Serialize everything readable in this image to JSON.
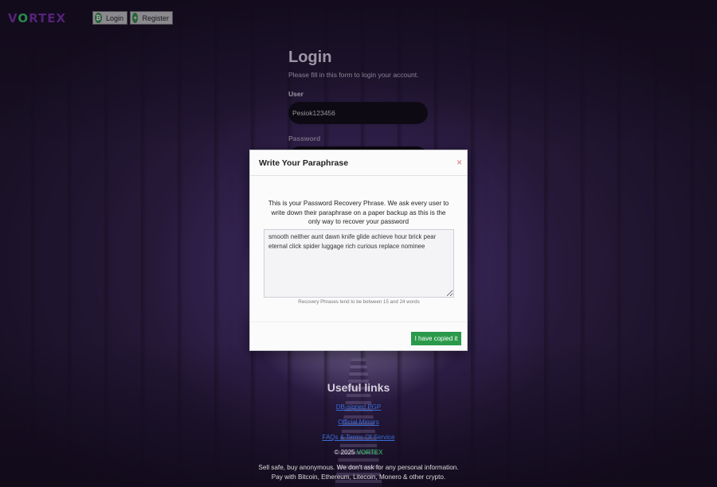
{
  "header": {
    "logo": {
      "part1": "V",
      "part2": "O",
      "part3": "RTEX"
    },
    "login_label": "Login",
    "register_label": "Register"
  },
  "login": {
    "title": "Login",
    "subtitle": "Please fill in this form to login your account.",
    "user_label": "User",
    "user_value": "Pesiok123456",
    "password_label": "Password"
  },
  "modal": {
    "title": "Write Your Paraphrase",
    "close_symbol": "×",
    "message": "This is your Password Recovery Phrase. We ask every user to write down their paraphrase on a paper backup as this is the only way to recover your password",
    "phrase": "smooth neither aunt dawn knife glide achieve hour brick pear eternal click spider luggage rich curious replace nominee",
    "hint": "Recovery Phrases tend to be between 15 and 24 words",
    "confirm_label": "I have copied it"
  },
  "footer": {
    "title": "Useful links",
    "links": [
      "DB-signed PGP",
      "Official Mirrors",
      "FAQs & Terms Of Service"
    ],
    "copyright_prefix": "© 2025 ",
    "copyright_brand": "VORTEX",
    "line1": "Sell safe, buy anonymous. We don't ask for any personal information.",
    "line2": "Pay with Bitcoin, Ethereum, Litecoin, Monero & other crypto."
  },
  "colors": {
    "accent_green": "#2a9a4a",
    "brand_purple": "#7a2fa8",
    "link_blue": "#3a6dd8",
    "close_red": "#e0707a"
  }
}
